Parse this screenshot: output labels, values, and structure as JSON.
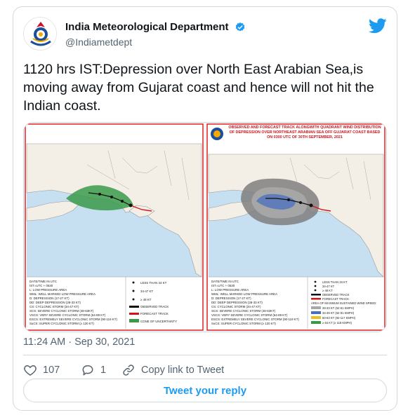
{
  "tweet": {
    "display_name": "India Meteorological Department",
    "handle": "@Indiametdept",
    "text": "1120 hrs IST:Depression over North East Arabian Sea,is moving away from Gujarat coast and hence will not hit the Indian coast.",
    "timestamp": "11:24 AM · Sep 30, 2021",
    "likes": "107",
    "replies": "1",
    "copy_link_label": "Copy link to Tweet",
    "reply_button_label": "Tweet your reply"
  },
  "left_map": {
    "legend_left": [
      "DATE/TIME IN UTC",
      "IST=UTC + 0530",
      "L: LOW PRESSURE AREA",
      "WML: WELL MARKED LOW PRESSURE AREA",
      "D: DEPRESSION (17-27 KT)",
      "DD: DEEP DEPRESSION (28-33 KT)",
      "CS: CYCLONIC STORM (34-47 KT)",
      "SCS: SEVERE CYCLONIC STORM (48-63KT)",
      "VSCS: VERY SEVERE CYCLONIC STORM (64-89 KT)",
      "ESCS: EXTREMELY SEVERE CYCLONIC STORM (90-119 KT)",
      "SuCS: SUPER CYCLONIC STORM (≥ 120 KT)"
    ],
    "legend_right": [
      "LESS THAN 34 KT",
      "34-47 KT",
      "≥ 48 KT",
      "OBSERVED TRACK",
      "FORECAST TRACK",
      "CONE OF UNCERTAINTY"
    ]
  },
  "right_map": {
    "title": "OBSERVED AND FORECAST TRACK ALONGWITH QUADRANT WIND DISTRIBUTION OF DEPRESSION OVER NORTHEAST ARABIAN SEA OFF GUJARAT COAST BASED ON 0300 UTC OF 30TH SEPTEMBER, 2021",
    "legend_left": [
      "DATE/TIME IN UTC",
      "IST=UTC + 0530",
      "L: LOW PRESSURE AREA",
      "WML: WELL MARKED LOW PRESSURE AREA",
      "D: DEPRESSION (17-27 KT)",
      "DD: DEEP DEPRESSION (28-33 KT)",
      "CS: CYCLONIC STORM (34-47 KT)",
      "SCS: SEVERE CYCLONIC STORM (48-63KT)",
      "VSCS: VERY SEVERE CYCLONIC STORM (64-89 KT)",
      "ESCS: EXTREMELY SEVERE CYCLONIC STORM (90-119 KT)",
      "SuCS: SUPER CYCLONIC STORM (≥ 120 KT)"
    ],
    "legend_right": [
      "LESS THAN 34 KT",
      "34-47 KT",
      "≥ 48 KT",
      "OBSERVED TRACK",
      "FORECAST TRACK",
      "AREA OF MAXIMUM SUSTAINED WIND SPEED:",
      "28-33 KT (52-61 KMPH)",
      "34-49 KT (62-91 KMPH)",
      "50-63 KT (92-117 KMPH)",
      "≥ 64 KT (≥ 118 KMPH)"
    ]
  },
  "colors": {
    "accent": "#1d9bf0",
    "text_secondary": "#536471",
    "border": "#cfd9de",
    "sea": "#c6dff1",
    "land": "#f3efe6",
    "cone": "#3a9a4a",
    "wind_outer": "#7f7f7f",
    "wind_inner": "#a8a8a8",
    "track_observed": "#111111",
    "track_forecast": "#d0141a"
  },
  "icons": [
    "imd-logo-icon",
    "verified-badge-icon",
    "twitter-bird-icon",
    "heart-icon",
    "reply-icon",
    "link-icon"
  ]
}
